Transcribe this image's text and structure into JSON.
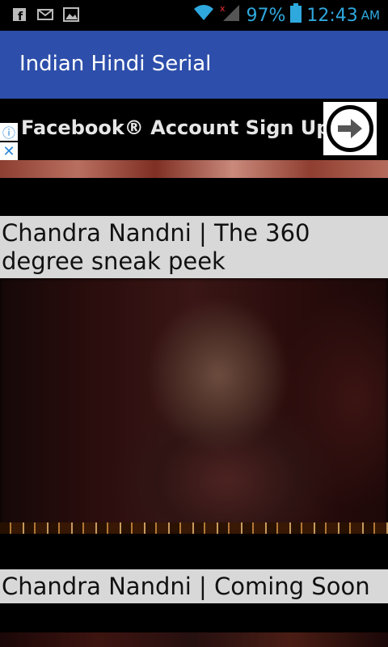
{
  "status_bar": {
    "battery": "97%",
    "time": "12:43",
    "ampm": "AM",
    "icons": [
      "facebook-icon",
      "gmail-icon",
      "gallery-icon",
      "wifi-icon",
      "no-signal-icon",
      "battery-icon"
    ]
  },
  "app_bar": {
    "title": "Indian Hindi Serial",
    "color": "#2d4eaa"
  },
  "ad": {
    "text": "Facebook® Account Sign Up",
    "info_icon": "info-icon",
    "close_icon": "close-icon",
    "arrow_icon": "arrow-right-icon"
  },
  "videos": [
    {
      "title": "Chandra Nandni | The 360 degree sneak peek"
    },
    {
      "title": "Chandra Nandni | Coming Soon"
    }
  ]
}
